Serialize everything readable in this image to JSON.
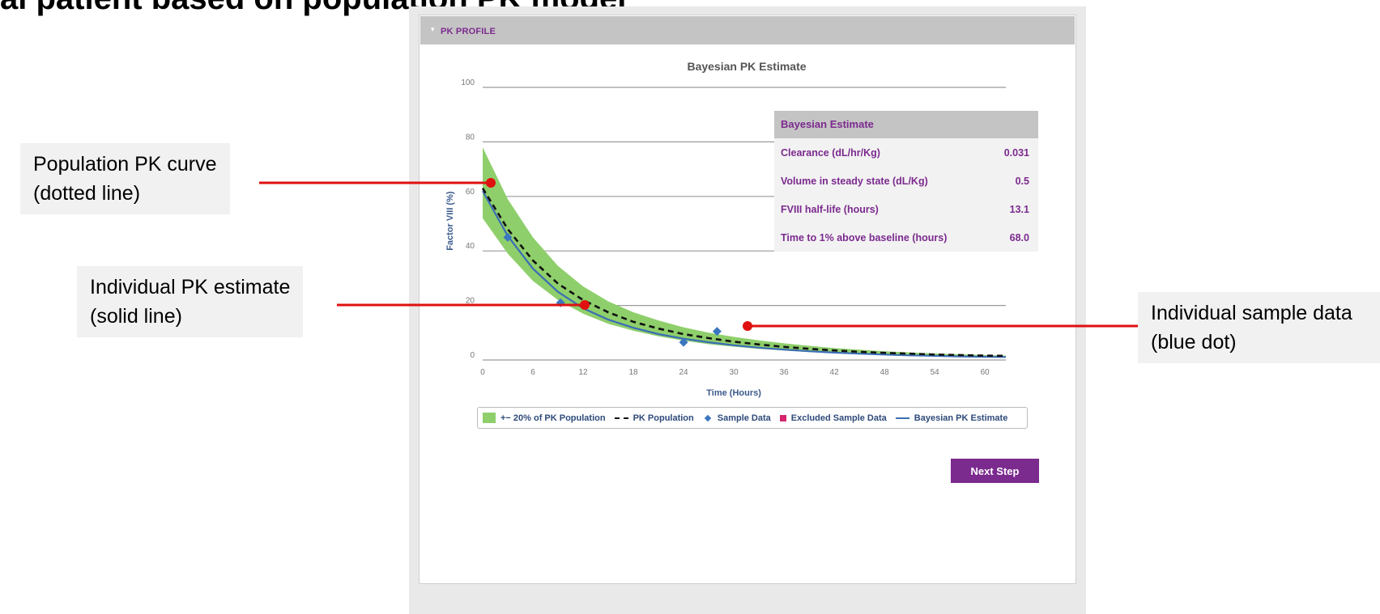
{
  "slide": {
    "title": "al patient based on population PK model"
  },
  "panel": {
    "header_title": "PK PROFILE",
    "header_caret": "▾"
  },
  "estimate_table": {
    "header": "Bayesian Estimate",
    "rows": [
      {
        "label": "Clearance (dL/hr/Kg)",
        "value": "0.031"
      },
      {
        "label": "Volume in steady state (dL/Kg)",
        "value": "0.5"
      },
      {
        "label": "FVIII half-life (hours)",
        "value": "13.1"
      },
      {
        "label": "Time to 1% above baseline (hours)",
        "value": "68.0"
      }
    ]
  },
  "legend": [
    {
      "symbol": "band",
      "label": "+− 20% of PK Population"
    },
    {
      "symbol": "dash",
      "label": "PK Population"
    },
    {
      "symbol": "diamond",
      "label": "Sample Data"
    },
    {
      "symbol": "square",
      "label": "Excluded Sample Data"
    },
    {
      "symbol": "line",
      "label": "Bayesian PK Estimate"
    }
  ],
  "buttons": {
    "next_step": "Next Step"
  },
  "callouts": [
    {
      "id": "population",
      "line1": "Population PK curve",
      "line2": "(dotted line)"
    },
    {
      "id": "individual",
      "line1": "Individual PK estimate",
      "line2": "(solid line)"
    },
    {
      "id": "sample",
      "line1": "Individual sample data",
      "line2": "(blue dot)"
    }
  ],
  "colors": {
    "accent": "#7b2a8e",
    "band": "#8ecf6b",
    "population_line": "#111111",
    "estimate_line": "#3b6db5",
    "sample_points": "#3b77c0",
    "callout_line": "#e01010"
  },
  "chart_data": {
    "type": "line",
    "title": "Bayesian PK Estimate",
    "xlabel": "Time (Hours)",
    "ylabel": "Factor VIII (%)",
    "xlim": [
      0,
      62.5
    ],
    "ylim": [
      0,
      100
    ],
    "xticks": [
      0,
      6,
      12,
      18,
      24,
      30,
      36,
      42,
      48,
      54,
      60
    ],
    "yticks": [
      0,
      20,
      40,
      60,
      80,
      100
    ],
    "grid": "horizontal",
    "legend_position": "bottom",
    "band": {
      "name": "+− 20% of PK Population",
      "x": [
        0,
        3,
        6,
        9,
        12,
        15,
        18,
        21,
        24,
        27,
        30,
        33,
        36,
        39,
        42,
        45,
        48,
        51,
        54,
        57,
        60,
        62.5
      ],
      "upper": [
        78,
        59,
        45,
        34.5,
        27,
        21.5,
        17.5,
        14.5,
        12,
        10,
        8.5,
        7.2,
        6.1,
        5.2,
        4.4,
        3.8,
        3.2,
        2.8,
        2.4,
        2.1,
        1.8,
        1.6
      ],
      "lower": [
        52,
        39,
        29,
        22,
        17,
        13.3,
        10.7,
        8.7,
        7.1,
        5.8,
        4.9,
        4.1,
        3.5,
        2.9,
        2.5,
        2.1,
        1.8,
        1.5,
        1.3,
        1.1,
        1.0,
        0.9
      ]
    },
    "series": [
      {
        "name": "PK Population",
        "style": "dashed",
        "x": [
          0,
          3,
          6,
          9,
          12,
          15,
          18,
          21,
          24,
          27,
          30,
          33,
          36,
          39,
          42,
          45,
          48,
          51,
          54,
          57,
          60,
          62.5
        ],
        "y": [
          63,
          48,
          36.5,
          28,
          22,
          17.5,
          14,
          11.5,
          9.5,
          8,
          6.7,
          5.7,
          4.8,
          4.1,
          3.5,
          3,
          2.6,
          2.3,
          2,
          1.8,
          1.6,
          1.5
        ]
      },
      {
        "name": "Bayesian PK Estimate",
        "style": "solid",
        "x": [
          0,
          3,
          6,
          9,
          12,
          15,
          18,
          21,
          24,
          27,
          30,
          33,
          36,
          39,
          42,
          45,
          48,
          51,
          54,
          57,
          60,
          62.5
        ],
        "y": [
          62,
          45.5,
          33.5,
          25,
          19,
          14.8,
          11.8,
          9.5,
          7.8,
          6.5,
          5.4,
          4.5,
          3.8,
          3.2,
          2.7,
          2.3,
          2.0,
          1.7,
          1.5,
          1.3,
          1.2,
          1.1
        ]
      }
    ],
    "samples": {
      "name": "Sample Data",
      "points": [
        {
          "x": 3,
          "y": 45
        },
        {
          "x": 9.3,
          "y": 21
        },
        {
          "x": 24,
          "y": 6.5
        },
        {
          "x": 28,
          "y": 10.5
        }
      ]
    }
  }
}
